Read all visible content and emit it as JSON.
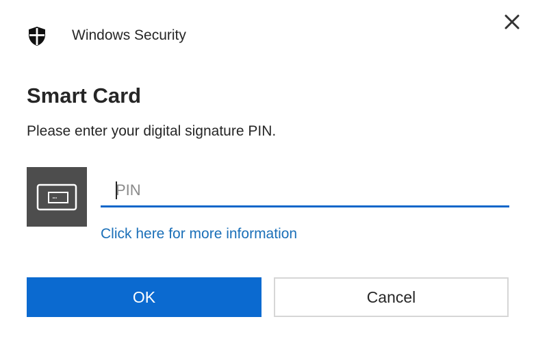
{
  "titlebar": {
    "app_title": "Windows Security",
    "app_icon": "shield-icon",
    "close_icon": "close-icon"
  },
  "content": {
    "heading": "Smart Card",
    "message": "Please enter your digital signature PIN.",
    "card_icon": "smart-card-icon",
    "pin_input": {
      "value": "",
      "placeholder": "PIN"
    },
    "more_info_link": "Click here for more information"
  },
  "buttons": {
    "ok_label": "OK",
    "cancel_label": "Cancel"
  },
  "colors": {
    "accent": "#0b6ad0",
    "link": "#1a6fb8",
    "input_underline": "#0a66c9",
    "card_tile": "#4d4d4d",
    "cancel_border": "#d6d6d6"
  }
}
